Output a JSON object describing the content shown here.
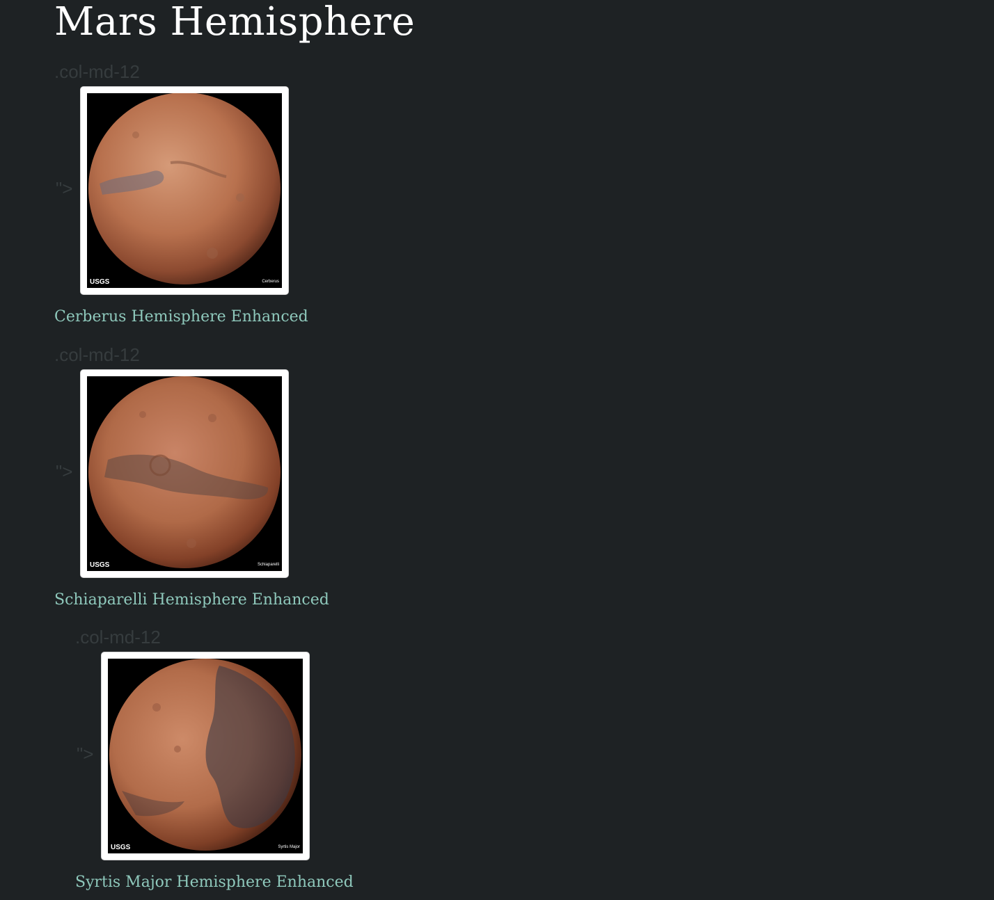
{
  "page": {
    "title": "Mars Hemisphere"
  },
  "hemispheres": [
    {
      "col_label": ".col-md-12",
      "stray_text": "\">",
      "title": "Cerberus Hemisphere Enhanced",
      "image_logo": "USGS",
      "image_caption": "Cerberus",
      "image_icon": "mars-cerberus-image"
    },
    {
      "col_label": ".col-md-12",
      "stray_text": "\">",
      "title": "Schiaparelli Hemisphere Enhanced",
      "image_logo": "USGS",
      "image_caption": "Schiaparelli",
      "image_icon": "mars-schiaparelli-image"
    },
    {
      "col_label": ".col-md-12",
      "stray_text": "\">",
      "title": "Syrtis Major Hemisphere Enhanced",
      "image_logo": "USGS",
      "image_caption": "Syrtis Major",
      "image_icon": "mars-syrtis-major-image"
    }
  ],
  "colors": {
    "background": "#1e2224",
    "title": "#ffffff",
    "link": "#8fc9bc",
    "muted_label": "#363c3e"
  }
}
